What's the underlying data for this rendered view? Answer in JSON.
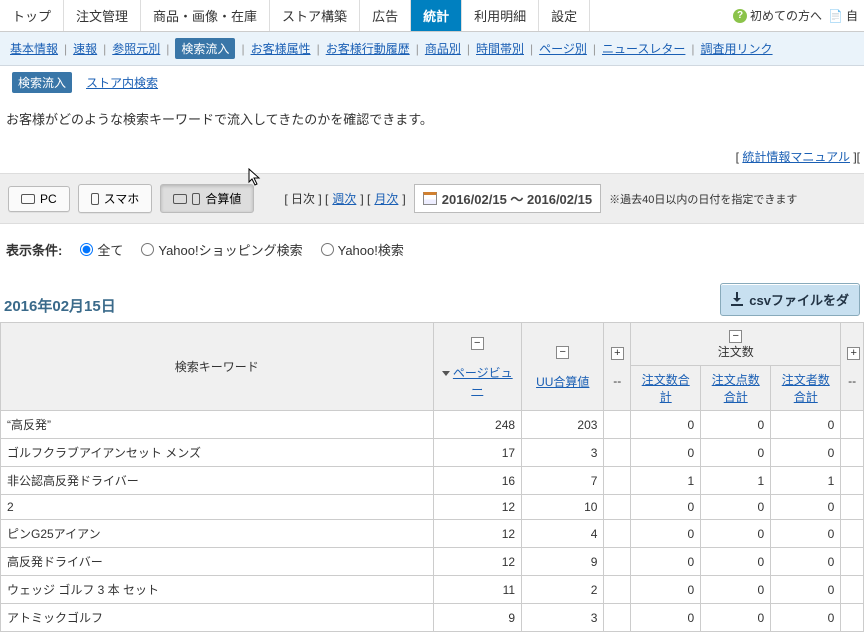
{
  "topnav": {
    "tabs": [
      "トップ",
      "注文管理",
      "商品・画像・在庫",
      "ストア構築",
      "広告",
      "統計",
      "利用明細",
      "設定"
    ],
    "active": 5,
    "right": {
      "beginner": "初めての方へ",
      "auto": "自"
    }
  },
  "subnav": {
    "items": [
      "基本情報",
      "速報",
      "参照元別",
      "検索流入",
      "お客様属性",
      "お客様行動履歴",
      "商品別",
      "時間帯別",
      "ページ別",
      "ニュースレター",
      "調査用リンク"
    ],
    "active": 3
  },
  "thirdnav": {
    "items": [
      "検索流入",
      "ストア内検索"
    ],
    "active": 0
  },
  "desc": "お客様がどのような検索キーワードで流入してきたのかを確認できます。",
  "infolinks": {
    "prefix": "[ ",
    "manual": "統計情報マニュアル",
    "sep": " ][ "
  },
  "toolbar": {
    "btn_pc": "PC",
    "btn_sp": "スマホ",
    "btn_sum": "合算値",
    "period_prefix": "[ 日次 ] [ ",
    "weekly": "週次",
    "mid": " ] [ ",
    "monthly": "月次",
    "suffix": " ]",
    "daterange": "2016/02/15 ～ 2016/02/15",
    "note": "※過去40日以内の日付を指定できます"
  },
  "conds": {
    "label": "表示条件:",
    "all": "全て",
    "yshop": "Yahoo!ショッピング検索",
    "ysearch": "Yahoo!検索"
  },
  "date_heading": "2016年02月15日",
  "csv": "csvファイルをダ",
  "table": {
    "head": {
      "kw": "検索キーワード",
      "pv": "ページビュー",
      "uu": "UU合算値",
      "group": "注文数",
      "ord1": "注文数合計",
      "ord2": "注文点数合計",
      "ord3": "注文者数合計",
      "dash": "--"
    },
    "rows": [
      {
        "kw": "“高反発”",
        "pv": 248,
        "uu": 203,
        "o1": 0,
        "o2": 0,
        "o3": 0
      },
      {
        "kw": "ゴルフクラブアイアンセット メンズ",
        "pv": 17,
        "uu": 3,
        "o1": 0,
        "o2": 0,
        "o3": 0
      },
      {
        "kw": "非公認高反発ドライバー",
        "pv": 16,
        "uu": 7,
        "o1": 1,
        "o2": 1,
        "o3": 1
      },
      {
        "kw": "2",
        "pv": 12,
        "uu": 10,
        "o1": 0,
        "o2": 0,
        "o3": 0
      },
      {
        "kw": "ピンG25アイアン",
        "pv": 12,
        "uu": 4,
        "o1": 0,
        "o2": 0,
        "o3": 0
      },
      {
        "kw": "高反発ドライバー",
        "pv": 12,
        "uu": 9,
        "o1": 0,
        "o2": 0,
        "o3": 0
      },
      {
        "kw": "ウェッジ ゴルフ 3 本 セット",
        "pv": 11,
        "uu": 2,
        "o1": 0,
        "o2": 0,
        "o3": 0
      },
      {
        "kw": "アトミックゴルフ",
        "pv": 9,
        "uu": 3,
        "o1": 0,
        "o2": 0,
        "o3": 0
      }
    ]
  }
}
